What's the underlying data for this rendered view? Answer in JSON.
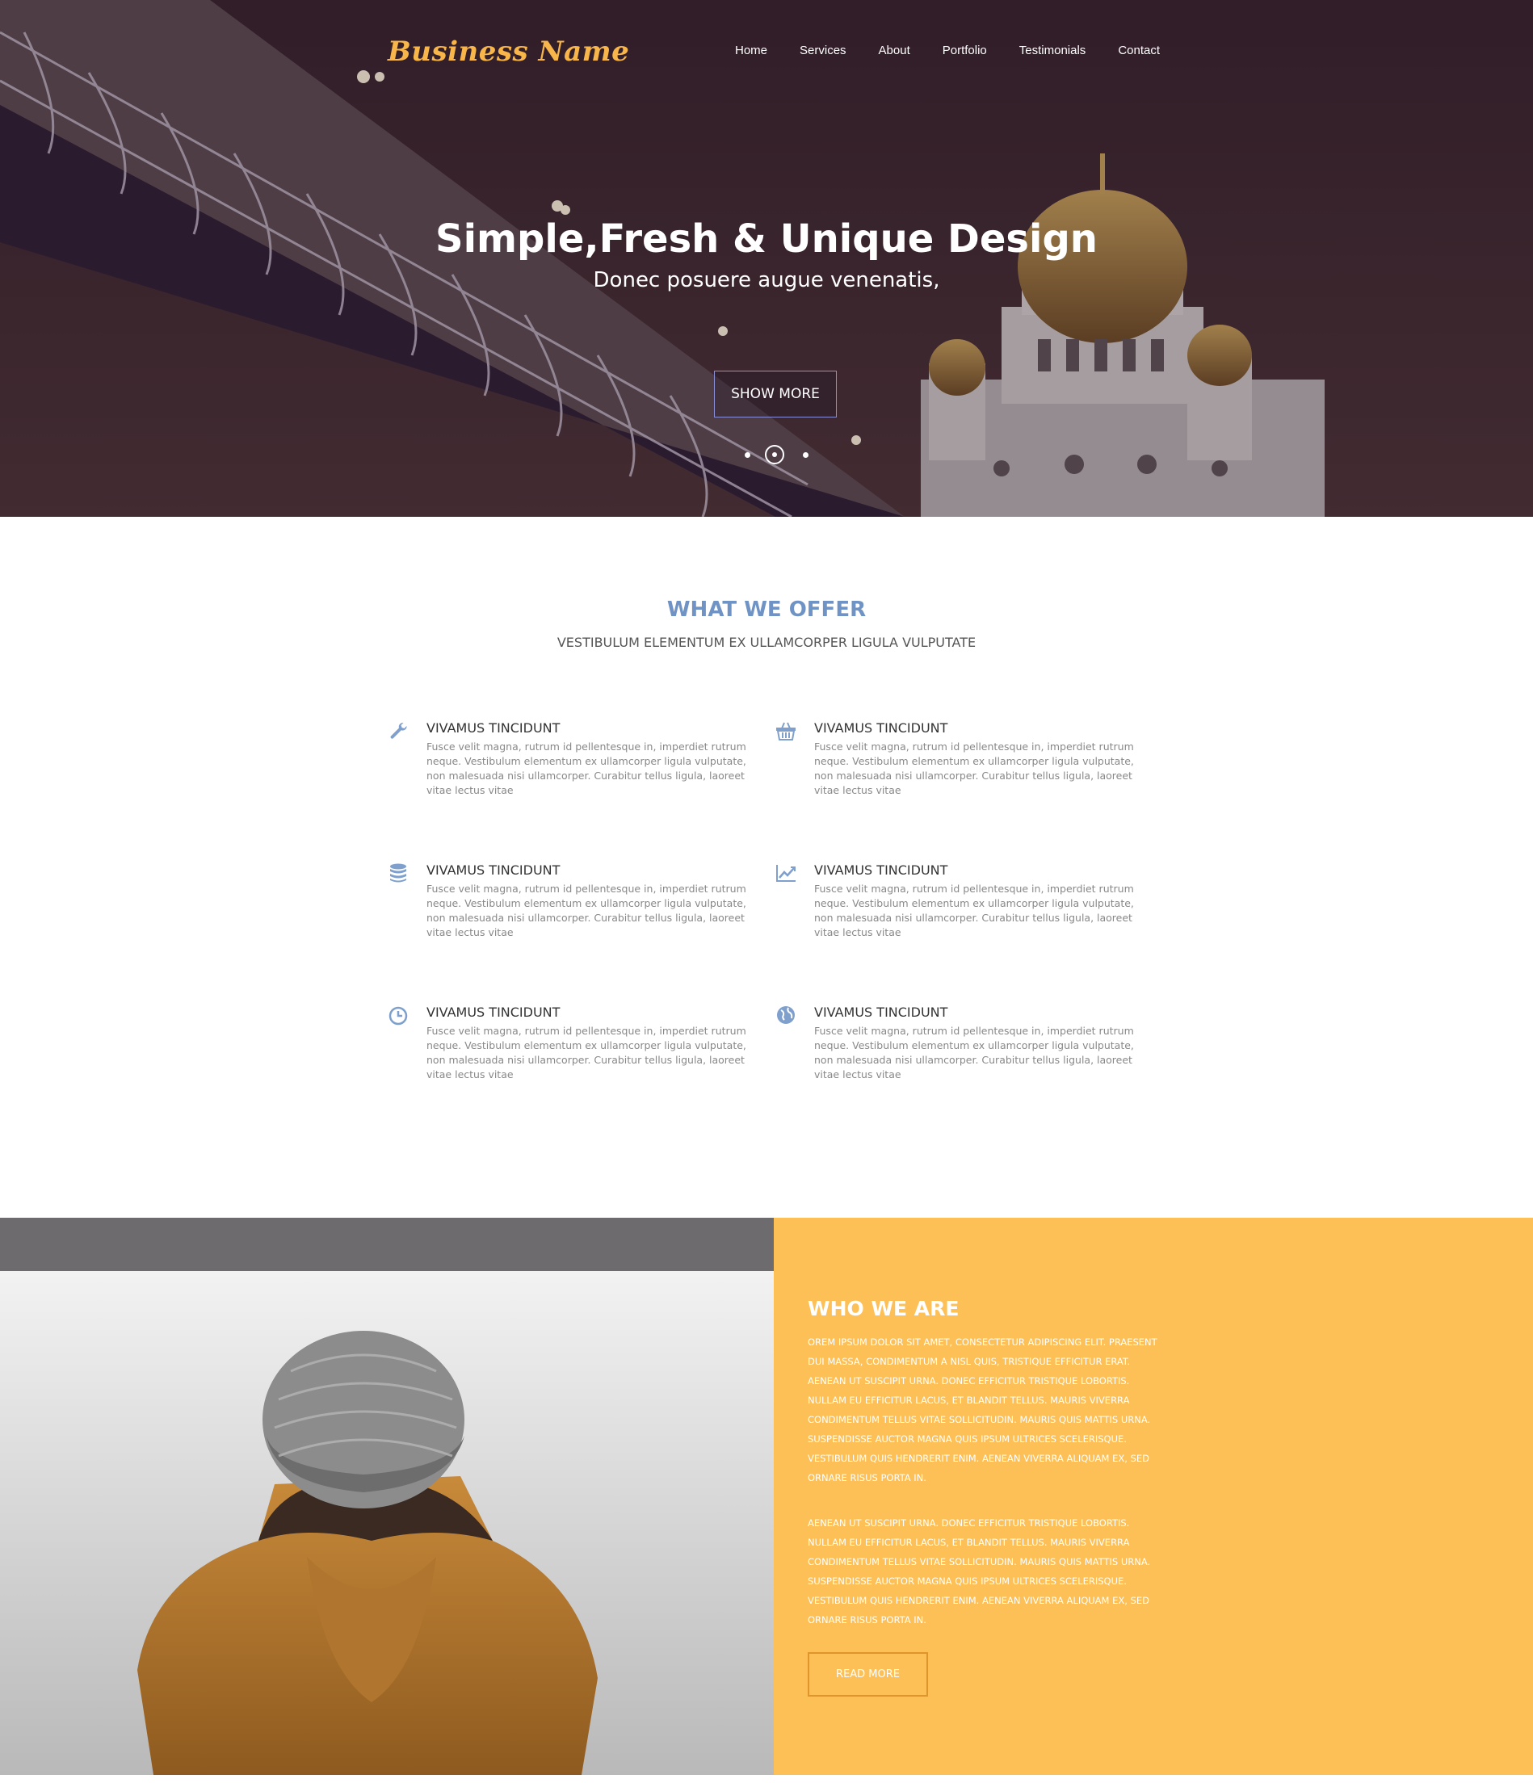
{
  "header": {
    "brand": "Business Name",
    "nav": [
      {
        "label": "Home"
      },
      {
        "label": "Services"
      },
      {
        "label": "About"
      },
      {
        "label": "Portfolio"
      },
      {
        "label": "Testimonials"
      },
      {
        "label": "Contact"
      }
    ]
  },
  "hero": {
    "title": "Simple,Fresh & Unique Design",
    "subtitle": "Donec posuere augue venenatis,",
    "button": "SHOW MORE"
  },
  "offer": {
    "title": "WHAT WE OFFER",
    "subtitle": "VESTIBULUM ELEMENTUM EX ULLAMCORPER LIGULA VULPUTATE",
    "features": [
      {
        "icon": "wrench-icon",
        "title": "VIVAMUS TINCIDUNT",
        "text": "Fusce velit magna, rutrum id pellentesque in, imperdiet rutrum neque. Vestibulum elementum ex ullamcorper ligula vulputate, non malesuada nisi ullamcorper. Curabitur tellus ligula, laoreet vitae lectus vitae"
      },
      {
        "icon": "basket-icon",
        "title": "VIVAMUS TINCIDUNT",
        "text": "Fusce velit magna, rutrum id pellentesque in, imperdiet rutrum neque. Vestibulum elementum ex ullamcorper ligula vulputate, non malesuada nisi ullamcorper. Curabitur tellus ligula, laoreet vitae lectus vitae"
      },
      {
        "icon": "database-icon",
        "title": "VIVAMUS TINCIDUNT",
        "text": "Fusce velit magna, rutrum id pellentesque in, imperdiet rutrum neque. Vestibulum elementum ex ullamcorper ligula vulputate, non malesuada nisi ullamcorper. Curabitur tellus ligula, laoreet vitae lectus vitae"
      },
      {
        "icon": "line-chart-icon",
        "title": "VIVAMUS TINCIDUNT",
        "text": "Fusce velit magna, rutrum id pellentesque in, imperdiet rutrum neque. Vestibulum elementum ex ullamcorper ligula vulputate, non malesuada nisi ullamcorper. Curabitur tellus ligula, laoreet vitae lectus vitae"
      },
      {
        "icon": "clock-icon",
        "title": "VIVAMUS TINCIDUNT",
        "text": "Fusce velit magna, rutrum id pellentesque in, imperdiet rutrum neque. Vestibulum elementum ex ullamcorper ligula vulputate, non malesuada nisi ullamcorper. Curabitur tellus ligula, laoreet vitae lectus vitae"
      },
      {
        "icon": "globe-icon",
        "title": "VIVAMUS TINCIDUNT",
        "text": "Fusce velit magna, rutrum id pellentesque in, imperdiet rutrum neque. Vestibulum elementum ex ullamcorper ligula vulputate, non malesuada nisi ullamcorper. Curabitur tellus ligula, laoreet vitae lectus vitae"
      }
    ]
  },
  "who": {
    "title": "WHO WE ARE",
    "paragraph1": "OREM IPSUM DOLOR SIT AMET, CONSECTETUR ADIPISCING ELIT. PRAESENT DUI MASSA, CONDIMENTUM A NISL QUIS, TRISTIQUE EFFICITUR ERAT. AENEAN UT SUSCIPIT URNA. DONEC EFFICITUR TRISTIQUE LOBORTIS. NULLAM EU EFFICITUR LACUS, ET BLANDIT TELLUS. MAURIS VIVERRA CONDIMENTUM TELLUS VITAE SOLLICITUDIN. MAURIS QUIS MATTIS URNA. SUSPENDISSE AUCTOR MAGNA QUIS IPSUM ULTRICES SCELERISQUE. VESTIBULUM QUIS HENDRERIT ENIM. AENEAN VIVERRA ALIQUAM EX, SED ORNARE RISUS PORTA IN.",
    "paragraph2": "AENEAN UT SUSCIPIT URNA. DONEC EFFICITUR TRISTIQUE LOBORTIS. NULLAM EU EFFICITUR LACUS, ET BLANDIT TELLUS. MAURIS VIVERRA CONDIMENTUM TELLUS VITAE SOLLICITUDIN. MAURIS QUIS MATTIS URNA. SUSPENDISSE AUCTOR MAGNA QUIS IPSUM ULTRICES SCELERISQUE. VESTIBULUM QUIS HENDRERIT ENIM. AENEAN VIVERRA ALIQUAM EX, SED ORNARE RISUS PORTA IN.",
    "button": "READ MORE"
  },
  "colors": {
    "accent": "#f7b54a",
    "offer_title": "#6f93c4",
    "who_panel": "#fdc057",
    "hero_bg": "#3a2528"
  }
}
